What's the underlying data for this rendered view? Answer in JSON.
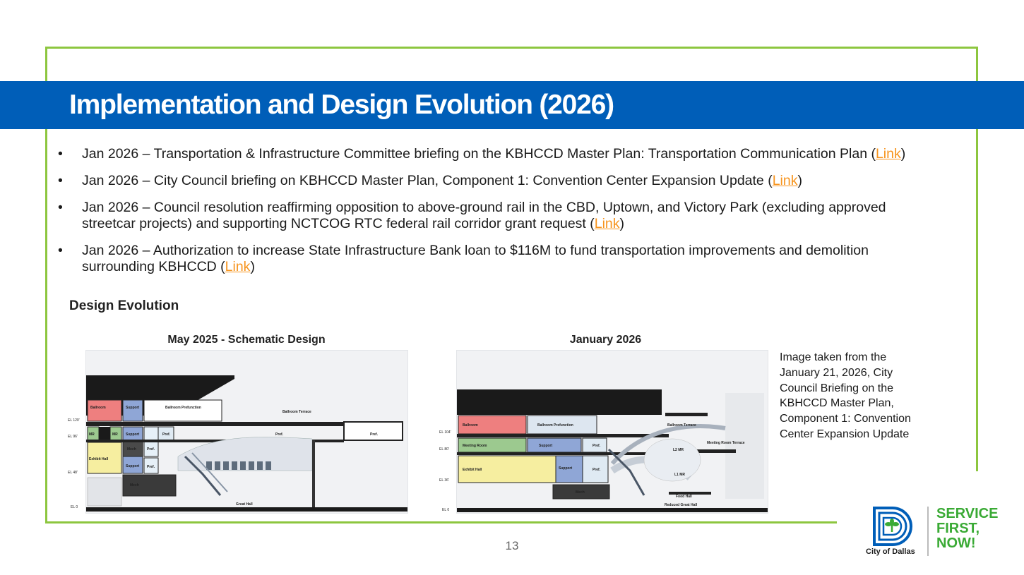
{
  "slide": {
    "title": "Implementation and Design Evolution (2026)",
    "bullet_marker": "•",
    "bullets": [
      {
        "text": "Jan 2026 – Transportation & Infrastructure Committee briefing on the KBHCCD Master Plan: Transportation Communication Plan (",
        "link": "Link",
        "tail": ")"
      },
      {
        "text": "Jan 2026 – City Council briefing on KBHCCD Master Plan, Component 1: Convention Center Expansion Update (",
        "link": "Link",
        "tail": ")"
      },
      {
        "text": "Jan 2026 – Council resolution reaffirming opposition to above-ground rail in the CBD, Uptown, and Victory Park (excluding approved streetcar projects) and supporting NCTCOG RTC federal rail corridor grant request (",
        "link": "Link",
        "tail": ")"
      },
      {
        "text": "Jan 2026 – Authorization to increase State Infrastructure Bank loan to $116M to fund transportation improvements and demolition surrounding KBHCCD (",
        "link": "Link",
        "tail": ")"
      }
    ],
    "subheading": "Design Evolution",
    "diagrams": [
      {
        "title": "May 2025 - Schematic Design",
        "elevations": [
          "EL 120'",
          "EL 96'",
          "EL 48'",
          "EL 0"
        ],
        "rooms": [
          "Ballroom",
          "Support",
          "Ballroom Prefunction",
          "Ballroom Terrace",
          "MR",
          "MR",
          "Support",
          "Pref.",
          "Pref.",
          "Pref.",
          "Mech",
          "Pref.",
          "Exhibit Hall",
          "Support",
          "Pref.",
          "Mech",
          "Great Hall"
        ]
      },
      {
        "title": "January 2026",
        "elevations": [
          "EL 104'",
          "EL 80'",
          "EL 36'",
          "EL 0"
        ],
        "rooms": [
          "Ballroom",
          "Ballroom Prefunction",
          "Ballroom Terrace",
          "Meeting Room",
          "Support",
          "Pref.",
          "Meeting Room Terrace",
          "L2 MR",
          "Exhibit Hall",
          "Support",
          "Pref.",
          "L1 MR",
          "Mech",
          "Food Hall",
          "Reduced Great Hall"
        ]
      }
    ],
    "caption": "Image taken from the January 21, 2026, City Council Briefing on the KBHCCD Master Plan, Component 1: Convention Center Expansion Update",
    "page_number": "13"
  },
  "logo": {
    "city": "City of Dallas",
    "slogan": "SERVICE FIRST, NOW!"
  },
  "colors": {
    "title_band": "#005eb8",
    "frame": "#8dc63f",
    "link": "#f7941d",
    "slogan": "#3aaa35"
  }
}
